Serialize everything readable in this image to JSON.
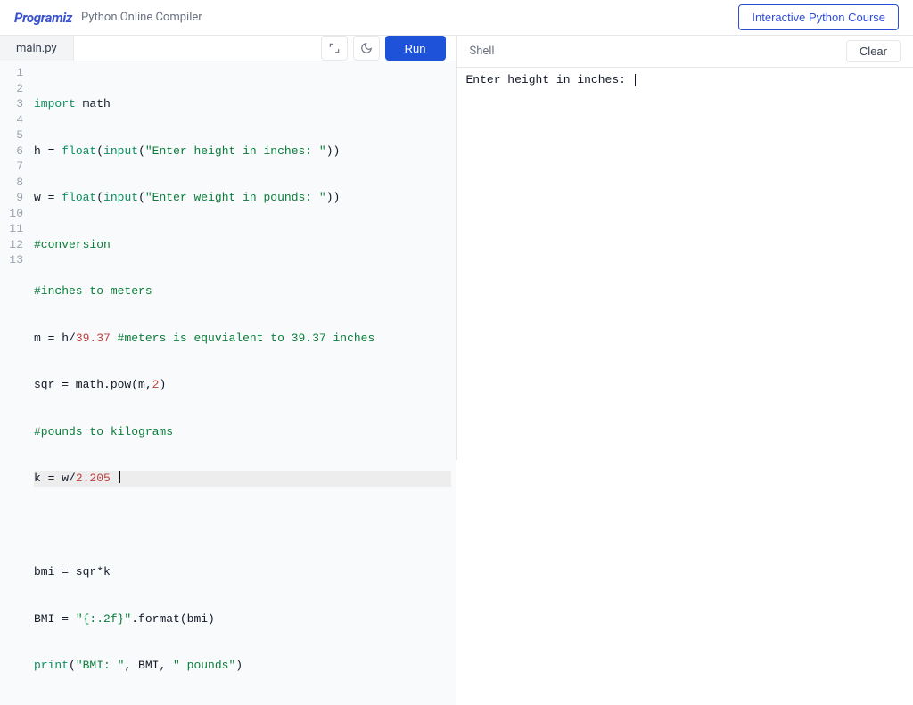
{
  "header": {
    "brand": "Programiz",
    "subtitle": "Python Online Compiler",
    "course_button": "Interactive Python Course"
  },
  "editor": {
    "filename": "main.py",
    "run_label": "Run",
    "line_numbers": [
      "1",
      "2",
      "3",
      "4",
      "5",
      "6",
      "7",
      "8",
      "9",
      "10",
      "11",
      "12",
      "13"
    ],
    "code": {
      "l1": {
        "a": "import",
        "b": " math"
      },
      "l2": {
        "a": "h = ",
        "b": "float",
        "c": "(",
        "d": "input",
        "e": "(",
        "f": "\"Enter height in inches: \"",
        "g": "))"
      },
      "l3": {
        "a": "w = ",
        "b": "float",
        "c": "(",
        "d": "input",
        "e": "(",
        "f": "\"Enter weight in pounds: \"",
        "g": "))"
      },
      "l4": "#conversion",
      "l5": "#inches to meters",
      "l6": {
        "a": "m = h/",
        "b": "39.37",
        "c": " ",
        "d": "#meters is equvialent to 39.37 inches"
      },
      "l7": {
        "a": "sqr = math.pow(m,",
        "b": "2",
        "c": ")"
      },
      "l8": "#pounds to kilograms",
      "l9": {
        "a": "k = w/",
        "b": "2.205",
        "c": " "
      },
      "l10": "",
      "l11": "bmi = sqr*k",
      "l12": {
        "a": "BMI = ",
        "b": "\"{:.2f}\"",
        "c": ".format(bmi)"
      },
      "l13": {
        "a": "print",
        "b": "(",
        "c": "\"BMI: \"",
        "d": ", BMI, ",
        "e": "\" pounds\"",
        "f": ")"
      }
    }
  },
  "shell": {
    "title": "Shell",
    "clear_label": "Clear",
    "output_line1": "Enter height in inches: "
  }
}
